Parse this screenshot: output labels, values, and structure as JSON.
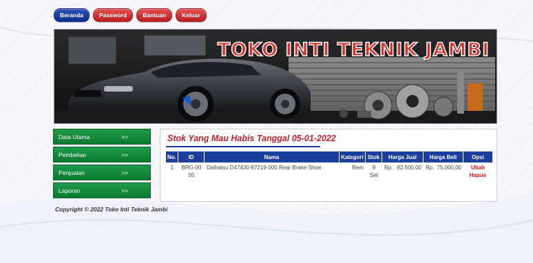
{
  "nav": [
    {
      "label": "Beranda",
      "color": "#1d3a9c"
    },
    {
      "label": "Password",
      "color": "#c8242a"
    },
    {
      "label": "Bantuan",
      "color": "#c8242a"
    },
    {
      "label": "Keluar",
      "color": "#c8242a"
    }
  ],
  "banner": {
    "title": "TOKO INTI TEKNIK JAMBI"
  },
  "sidebar": {
    "items": [
      {
        "label": "Data Utama",
        "arrow": ">>"
      },
      {
        "label": "Pembelian",
        "arrow": ">>"
      },
      {
        "label": "Penjualan",
        "arrow": ">>"
      },
      {
        "label": "Laporan",
        "arrow": ">>"
      }
    ]
  },
  "content": {
    "title": "Stok Yang Mau Habis Tanggal 05-01-2022",
    "columns": [
      "No.",
      "ID",
      "Nama",
      "Kategori",
      "Stok",
      "Harga Jual",
      "Harga Beli",
      "Opsi"
    ],
    "rows": [
      {
        "no": "1",
        "id": "BRG-0005",
        "nama": "Daihatsu D47430-87219-000 Rear Brake Shoe",
        "kategori": "Rem",
        "stok": "9 Set",
        "harga_jual_currency": "Rp.",
        "harga_jual": "82.500,00",
        "harga_beli_currency": "Rp.",
        "harga_beli": "75.000,00",
        "opsi_edit": "Ubah",
        "opsi_delete": "Hapus"
      }
    ]
  },
  "footer": {
    "copyright": "Copyright © 2022 Toko Inti Teknik Jambi"
  },
  "colors": {
    "sidebar_green": "#138a3e",
    "header_blue": "#1b3e9e",
    "title_red": "#c21f2a"
  }
}
